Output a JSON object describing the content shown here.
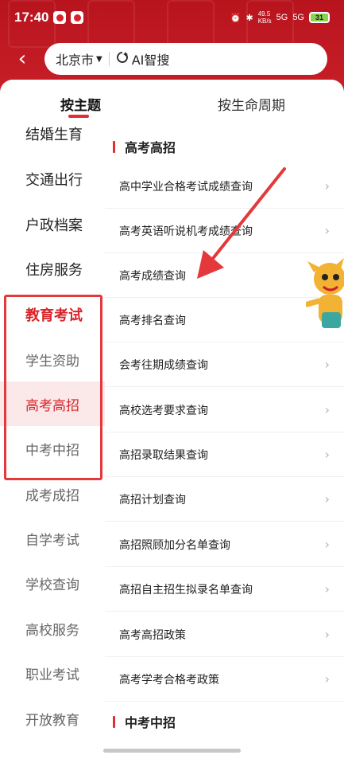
{
  "status_bar": {
    "time": "17:40",
    "net_speed_top": "49.5",
    "net_speed_bottom": "KB/s",
    "signal1": "5G",
    "signal2": "5G",
    "battery": "31"
  },
  "search": {
    "back": "‹",
    "city": "北京市",
    "caret": "▼",
    "ai_label": "AI智搜"
  },
  "tabs": {
    "theme": "按主题",
    "lifecycle": "按生命周期"
  },
  "left_menu": [
    {
      "label": "结婚生育"
    },
    {
      "label": "交通出行"
    },
    {
      "label": "户政档案"
    },
    {
      "label": "住房服务"
    },
    {
      "label": "教育考试"
    },
    {
      "label": "学生资助"
    },
    {
      "label": "高考高招"
    },
    {
      "label": "中考中招"
    },
    {
      "label": "成考成招"
    },
    {
      "label": "自学考试"
    },
    {
      "label": "学校查询"
    },
    {
      "label": "高校服务"
    },
    {
      "label": "职业考试"
    },
    {
      "label": "开放教育"
    }
  ],
  "section_1": {
    "title": "高考高招"
  },
  "rows": [
    {
      "label": "高中学业合格考试成绩查询"
    },
    {
      "label": "高考英语听说机考成绩查询"
    },
    {
      "label": "高考成绩查询"
    },
    {
      "label": "高考排名查询"
    },
    {
      "label": "会考往期成绩查询"
    },
    {
      "label": "高校选考要求查询"
    },
    {
      "label": "高招录取结果查询"
    },
    {
      "label": "高招计划查询"
    },
    {
      "label": "高招照顾加分名单查询"
    },
    {
      "label": "高招自主招生拟录名单查询"
    },
    {
      "label": "高考高招政策"
    },
    {
      "label": "高考学考合格考政策"
    }
  ],
  "section_2": {
    "title": "中考中招"
  },
  "colors": {
    "brand_red": "#d8232a",
    "arrow": "#e5383b",
    "selected_bg": "#fbe9ea"
  }
}
